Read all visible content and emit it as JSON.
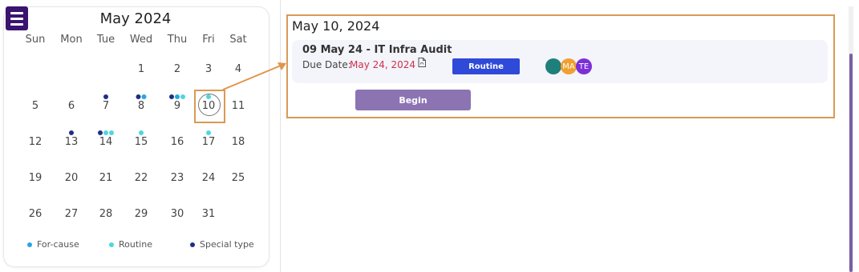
{
  "calendar": {
    "month_title": "May 2024",
    "weekdays": [
      "Sun",
      "Mon",
      "Tue",
      "Wed",
      "Thu",
      "Fri",
      "Sat"
    ],
    "weeks": [
      [
        "",
        "",
        "",
        "1",
        "2",
        "3",
        "4"
      ],
      [
        "5",
        "6",
        "7",
        "8",
        "9",
        "10",
        "11"
      ],
      [
        "12",
        "13",
        "14",
        "15",
        "16",
        "17",
        "18"
      ],
      [
        "19",
        "20",
        "21",
        "22",
        "23",
        "24",
        "25"
      ],
      [
        "26",
        "27",
        "28",
        "29",
        "30",
        "31",
        ""
      ]
    ],
    "selected_day": "10",
    "events": {
      "7": [
        "special"
      ],
      "8": [
        "special",
        "for_cause"
      ],
      "9": [
        "special",
        "for_cause",
        "routine"
      ],
      "10": [
        "routine"
      ],
      "13": [
        "special"
      ],
      "14": [
        "special",
        "routine",
        "routine"
      ],
      "15": [
        "routine"
      ],
      "17": [
        "routine"
      ]
    }
  },
  "legend": [
    {
      "key": "for_cause",
      "label": "For-cause",
      "color": "#2aa5e0"
    },
    {
      "key": "routine",
      "label": "Routine",
      "color": "#4fd6dc"
    },
    {
      "key": "special",
      "label": "Special type",
      "color": "#1f2f86"
    }
  ],
  "detail": {
    "date_title": "May 10, 2024",
    "task": {
      "title": "09 May 24 - IT Infra Audit",
      "due_label": "Due Date:",
      "due_value": "May 24, 2024",
      "type_badge": "Routine",
      "avatars": [
        {
          "initials": "",
          "color": "#1f7f7a"
        },
        {
          "initials": "MA",
          "color": "#f0a030"
        },
        {
          "initials": "TE",
          "color": "#7b2fd6"
        }
      ]
    },
    "begin_label": "Begin"
  },
  "colors": {
    "menu": "#3b1470",
    "highlight": "#d99a56",
    "begin": "#8c74b3",
    "badge": "#2f49d8"
  },
  "icons": {
    "menu": "hamburger-menu-icon",
    "attachment": "pdf-file-icon"
  }
}
